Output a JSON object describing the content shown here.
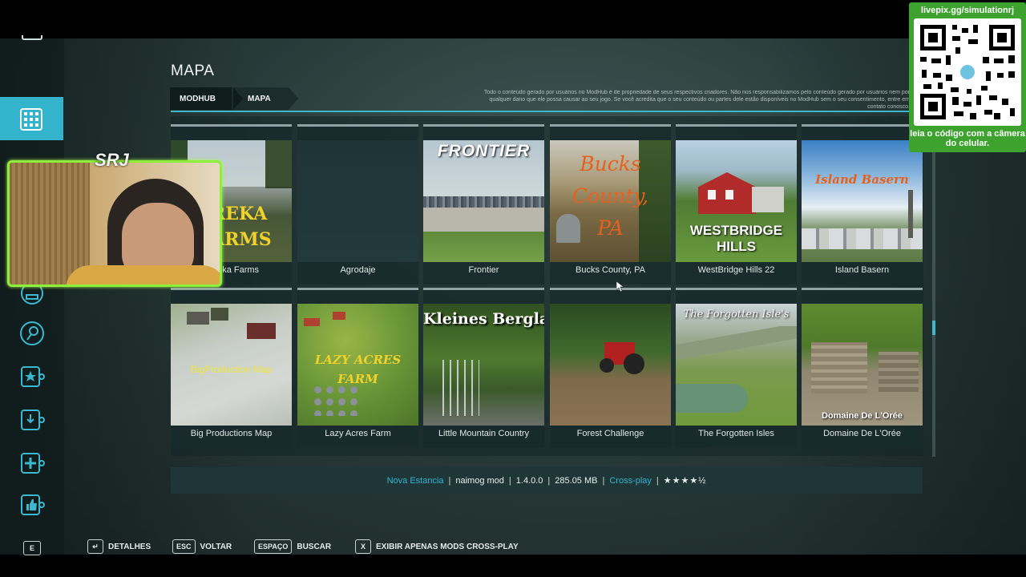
{
  "page": {
    "title": "MAPA"
  },
  "breadcrumb": [
    "MODHUB",
    "MAPA"
  ],
  "disclaimer": "Todo o conteúdo gerado por usuários no ModHub é de propriedade de seus respectivos criadores. Não nos responsabilizamos pelo conteúdo gerado por usuários nem por qualquer dano que ele possa causar ao seu jogo. Se você acredita que o seu conteúdo ou partes dele estão disponíveis no ModHub sem o seu consentimento, entre em contato conosco.",
  "maps": [
    {
      "label": "Eureka Farms",
      "thumb_text": "REKA ARMS",
      "thumb_color": "#f0d22b"
    },
    {
      "label": "Agrodaje",
      "thumb_text": "",
      "thumb_color": ""
    },
    {
      "label": "Frontier",
      "thumb_text": "FRONTIER",
      "thumb_color": "#ffffff"
    },
    {
      "label": "Bucks County, PA",
      "thumb_text": "Bucks County, PA",
      "thumb_color": "#e8611c"
    },
    {
      "label": "WestBridge Hills 22",
      "thumb_text": "WESTBRIDGE HILLS",
      "thumb_color": "#ffffff"
    },
    {
      "label": "Island Basern",
      "thumb_text": "Island Basern",
      "thumb_color": "#e8611c"
    },
    {
      "label": "Big Productions Map",
      "thumb_text": "BigProduction Map",
      "thumb_color": "#f0e63a"
    },
    {
      "label": "Lazy Acres Farm",
      "thumb_text": "LAZY ACRES FARM",
      "thumb_color": "#f0d22b"
    },
    {
      "label": "Little Mountain Country",
      "thumb_text": "Kleines Bergland",
      "thumb_color": "#ffffff"
    },
    {
      "label": "Forest Challenge",
      "thumb_text": "",
      "thumb_color": ""
    },
    {
      "label": "The Forgotten Isles",
      "thumb_text": "The Forgotten Isle's",
      "thumb_color": "#ffffff"
    },
    {
      "label": "Domaine De L'Orée",
      "thumb_text": "Domaine De L'Orée",
      "thumb_color": "#ffffff"
    }
  ],
  "infobar": {
    "name": "Nova Estancia",
    "author": "naimog mod",
    "version": "1.4.0.0",
    "size": "285.05 MB",
    "crossplay": "Cross-play",
    "stars": "★★★★½",
    "rating": 4.5
  },
  "hints": [
    {
      "key": "↵",
      "label": "DETALHES"
    },
    {
      "key": "ESC",
      "label": "VOLTAR"
    },
    {
      "key": "ESPAÇO",
      "label": "BUSCAR"
    },
    {
      "key": "X",
      "label": "EXIBIR APENAS MODS CROSS-PLAY"
    }
  ],
  "rail": {
    "bottom_key": "E"
  },
  "overlay": {
    "logo": "SRJ",
    "qr_url": "livepix.gg/simulationrj",
    "qr_caption": "leia o código com a câmera do celular."
  },
  "colors": {
    "accent": "#33b4cc",
    "cam_border": "#8ef03a",
    "qr_green": "#3da32e"
  }
}
